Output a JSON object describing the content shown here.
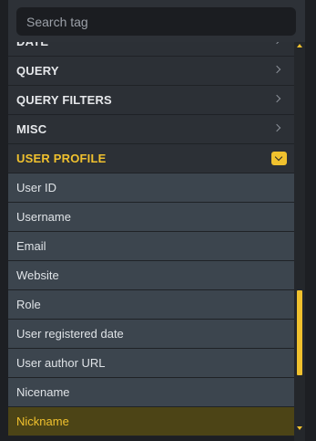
{
  "search": {
    "placeholder": "Search tag"
  },
  "categories": [
    {
      "label": "DATE"
    },
    {
      "label": "QUERY"
    },
    {
      "label": "QUERY FILTERS"
    },
    {
      "label": "MISC"
    },
    {
      "label": "USER PROFILE"
    }
  ],
  "user_profile_items": [
    {
      "label": "User ID"
    },
    {
      "label": "Username"
    },
    {
      "label": "Email"
    },
    {
      "label": "Website"
    },
    {
      "label": "Role"
    },
    {
      "label": "User registered date"
    },
    {
      "label": "User author URL"
    },
    {
      "label": "Nicename"
    },
    {
      "label": "Nickname"
    }
  ],
  "colors": {
    "accent": "#f0c12e",
    "category_bg": "#2c3036",
    "item_bg": "#3c454e",
    "active_item_bg": "#4c4416"
  },
  "icons": {
    "collapsed": "chevron-right-icon",
    "expanded": "chevron-down-icon"
  }
}
